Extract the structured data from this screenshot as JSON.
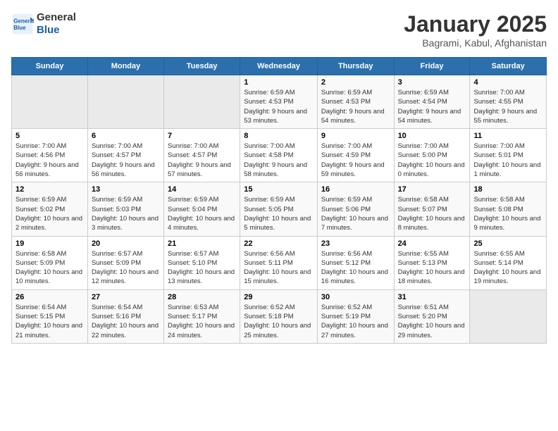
{
  "logo": {
    "line1": "General",
    "line2": "Blue"
  },
  "calendar": {
    "title": "January 2025",
    "subtitle": "Bagrami, Kabul, Afghanistan"
  },
  "weekdays": [
    "Sunday",
    "Monday",
    "Tuesday",
    "Wednesday",
    "Thursday",
    "Friday",
    "Saturday"
  ],
  "weeks": [
    [
      {
        "day": "",
        "info": ""
      },
      {
        "day": "",
        "info": ""
      },
      {
        "day": "",
        "info": ""
      },
      {
        "day": "1",
        "info": "Sunrise: 6:59 AM\nSunset: 4:53 PM\nDaylight: 9 hours and 53 minutes."
      },
      {
        "day": "2",
        "info": "Sunrise: 6:59 AM\nSunset: 4:53 PM\nDaylight: 9 hours and 54 minutes."
      },
      {
        "day": "3",
        "info": "Sunrise: 6:59 AM\nSunset: 4:54 PM\nDaylight: 9 hours and 54 minutes."
      },
      {
        "day": "4",
        "info": "Sunrise: 7:00 AM\nSunset: 4:55 PM\nDaylight: 9 hours and 55 minutes."
      }
    ],
    [
      {
        "day": "5",
        "info": "Sunrise: 7:00 AM\nSunset: 4:56 PM\nDaylight: 9 hours and 56 minutes."
      },
      {
        "day": "6",
        "info": "Sunrise: 7:00 AM\nSunset: 4:57 PM\nDaylight: 9 hours and 56 minutes."
      },
      {
        "day": "7",
        "info": "Sunrise: 7:00 AM\nSunset: 4:57 PM\nDaylight: 9 hours and 57 minutes."
      },
      {
        "day": "8",
        "info": "Sunrise: 7:00 AM\nSunset: 4:58 PM\nDaylight: 9 hours and 58 minutes."
      },
      {
        "day": "9",
        "info": "Sunrise: 7:00 AM\nSunset: 4:59 PM\nDaylight: 9 hours and 59 minutes."
      },
      {
        "day": "10",
        "info": "Sunrise: 7:00 AM\nSunset: 5:00 PM\nDaylight: 10 hours and 0 minutes."
      },
      {
        "day": "11",
        "info": "Sunrise: 7:00 AM\nSunset: 5:01 PM\nDaylight: 10 hours and 1 minute."
      }
    ],
    [
      {
        "day": "12",
        "info": "Sunrise: 6:59 AM\nSunset: 5:02 PM\nDaylight: 10 hours and 2 minutes."
      },
      {
        "day": "13",
        "info": "Sunrise: 6:59 AM\nSunset: 5:03 PM\nDaylight: 10 hours and 3 minutes."
      },
      {
        "day": "14",
        "info": "Sunrise: 6:59 AM\nSunset: 5:04 PM\nDaylight: 10 hours and 4 minutes."
      },
      {
        "day": "15",
        "info": "Sunrise: 6:59 AM\nSunset: 5:05 PM\nDaylight: 10 hours and 5 minutes."
      },
      {
        "day": "16",
        "info": "Sunrise: 6:59 AM\nSunset: 5:06 PM\nDaylight: 10 hours and 7 minutes."
      },
      {
        "day": "17",
        "info": "Sunrise: 6:58 AM\nSunset: 5:07 PM\nDaylight: 10 hours and 8 minutes."
      },
      {
        "day": "18",
        "info": "Sunrise: 6:58 AM\nSunset: 5:08 PM\nDaylight: 10 hours and 9 minutes."
      }
    ],
    [
      {
        "day": "19",
        "info": "Sunrise: 6:58 AM\nSunset: 5:09 PM\nDaylight: 10 hours and 10 minutes."
      },
      {
        "day": "20",
        "info": "Sunrise: 6:57 AM\nSunset: 5:09 PM\nDaylight: 10 hours and 12 minutes."
      },
      {
        "day": "21",
        "info": "Sunrise: 6:57 AM\nSunset: 5:10 PM\nDaylight: 10 hours and 13 minutes."
      },
      {
        "day": "22",
        "info": "Sunrise: 6:56 AM\nSunset: 5:11 PM\nDaylight: 10 hours and 15 minutes."
      },
      {
        "day": "23",
        "info": "Sunrise: 6:56 AM\nSunset: 5:12 PM\nDaylight: 10 hours and 16 minutes."
      },
      {
        "day": "24",
        "info": "Sunrise: 6:55 AM\nSunset: 5:13 PM\nDaylight: 10 hours and 18 minutes."
      },
      {
        "day": "25",
        "info": "Sunrise: 6:55 AM\nSunset: 5:14 PM\nDaylight: 10 hours and 19 minutes."
      }
    ],
    [
      {
        "day": "26",
        "info": "Sunrise: 6:54 AM\nSunset: 5:15 PM\nDaylight: 10 hours and 21 minutes."
      },
      {
        "day": "27",
        "info": "Sunrise: 6:54 AM\nSunset: 5:16 PM\nDaylight: 10 hours and 22 minutes."
      },
      {
        "day": "28",
        "info": "Sunrise: 6:53 AM\nSunset: 5:17 PM\nDaylight: 10 hours and 24 minutes."
      },
      {
        "day": "29",
        "info": "Sunrise: 6:52 AM\nSunset: 5:18 PM\nDaylight: 10 hours and 25 minutes."
      },
      {
        "day": "30",
        "info": "Sunrise: 6:52 AM\nSunset: 5:19 PM\nDaylight: 10 hours and 27 minutes."
      },
      {
        "day": "31",
        "info": "Sunrise: 6:51 AM\nSunset: 5:20 PM\nDaylight: 10 hours and 29 minutes."
      },
      {
        "day": "",
        "info": ""
      }
    ]
  ]
}
